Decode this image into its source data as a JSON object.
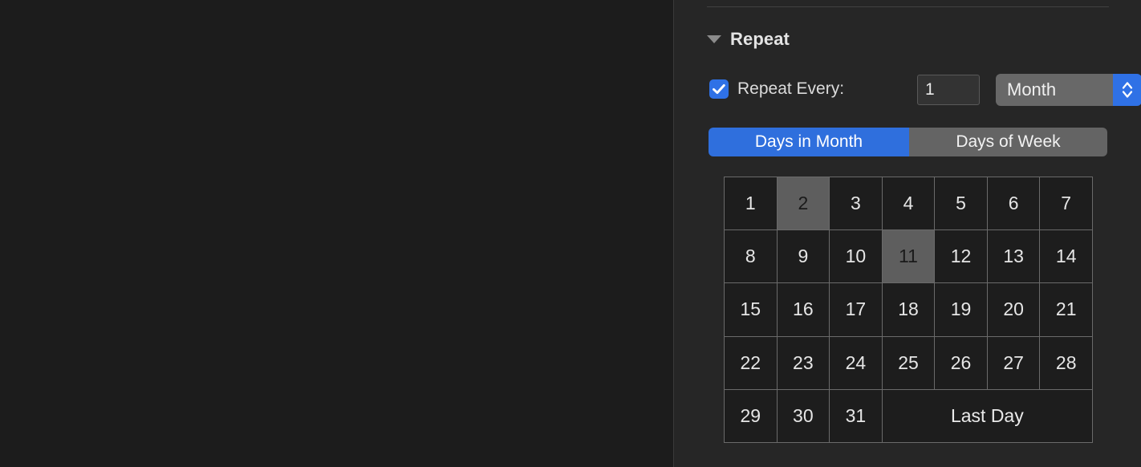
{
  "panel": {
    "section_title": "Repeat",
    "disclosure_icon": "triangle-down-icon"
  },
  "repeat_every": {
    "checkbox_checked": true,
    "checkbox_icon": "checkmark-icon",
    "label": "Repeat Every:",
    "interval_value": "1",
    "interval_placeholder": "1",
    "unit_value": "Month",
    "stepper_icon": "chevron-up-down-icon"
  },
  "mode_selector": {
    "segments": [
      {
        "label": "Days in Month",
        "selected": true
      },
      {
        "label": "Days of Week",
        "selected": false
      }
    ]
  },
  "day_grid": {
    "cells": [
      {
        "label": "1",
        "highlighted": false,
        "span": 1
      },
      {
        "label": "2",
        "highlighted": true,
        "span": 1
      },
      {
        "label": "3",
        "highlighted": false,
        "span": 1
      },
      {
        "label": "4",
        "highlighted": false,
        "span": 1
      },
      {
        "label": "5",
        "highlighted": false,
        "span": 1
      },
      {
        "label": "6",
        "highlighted": false,
        "span": 1
      },
      {
        "label": "7",
        "highlighted": false,
        "span": 1
      },
      {
        "label": "8",
        "highlighted": false,
        "span": 1
      },
      {
        "label": "9",
        "highlighted": false,
        "span": 1
      },
      {
        "label": "10",
        "highlighted": false,
        "span": 1
      },
      {
        "label": "11",
        "highlighted": true,
        "span": 1
      },
      {
        "label": "12",
        "highlighted": false,
        "span": 1
      },
      {
        "label": "13",
        "highlighted": false,
        "span": 1
      },
      {
        "label": "14",
        "highlighted": false,
        "span": 1
      },
      {
        "label": "15",
        "highlighted": false,
        "span": 1
      },
      {
        "label": "16",
        "highlighted": false,
        "span": 1
      },
      {
        "label": "17",
        "highlighted": false,
        "span": 1
      },
      {
        "label": "18",
        "highlighted": false,
        "span": 1
      },
      {
        "label": "19",
        "highlighted": false,
        "span": 1
      },
      {
        "label": "20",
        "highlighted": false,
        "span": 1
      },
      {
        "label": "21",
        "highlighted": false,
        "span": 1
      },
      {
        "label": "22",
        "highlighted": false,
        "span": 1
      },
      {
        "label": "23",
        "highlighted": false,
        "span": 1
      },
      {
        "label": "24",
        "highlighted": false,
        "span": 1
      },
      {
        "label": "25",
        "highlighted": false,
        "span": 1
      },
      {
        "label": "26",
        "highlighted": false,
        "span": 1
      },
      {
        "label": "27",
        "highlighted": false,
        "span": 1
      },
      {
        "label": "28",
        "highlighted": false,
        "span": 1
      },
      {
        "label": "29",
        "highlighted": false,
        "span": 1
      },
      {
        "label": "30",
        "highlighted": false,
        "span": 1
      },
      {
        "label": "31",
        "highlighted": false,
        "span": 1
      },
      {
        "label": "Last Day",
        "highlighted": false,
        "span": 4
      }
    ]
  },
  "colors": {
    "accent_blue": "#2f71e6",
    "segment_blue": "#2f6fdd",
    "panel_bg": "#262626",
    "canvas_bg": "#1c1c1c",
    "cell_bg": "#1d1d1d",
    "cell_highlight": "#5e5e5e",
    "grid_line": "#6a6a6a"
  }
}
